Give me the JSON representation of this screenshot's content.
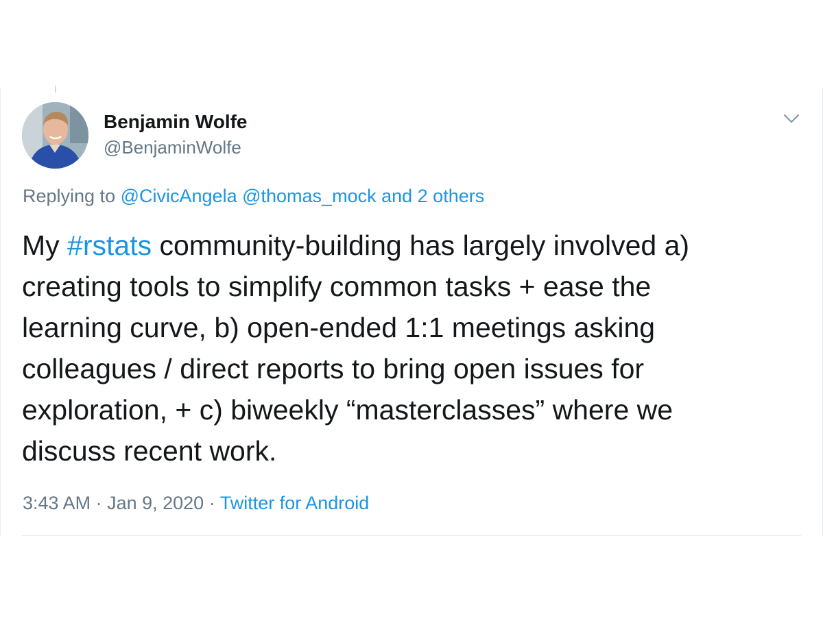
{
  "author": {
    "name": "Benjamin Wolfe",
    "handle": "@BenjaminWolfe"
  },
  "reply": {
    "prefix": "Replying to",
    "mention_1": "@CivicAngela",
    "mention_2": "@thomas_mock",
    "others": "and 2 others"
  },
  "tweet": {
    "line1_a": "My ",
    "hashtag": "#rstats",
    "line1_b": " community-building has largely involved a)",
    "line2": "creating tools to simplify common tasks + ease the",
    "line3": "learning curve, b) open-ended 1:1 meetings asking",
    "line4": "colleagues / direct reports to bring open issues for",
    "line5": "exploration, + c) biweekly “masterclasses” where we",
    "line6": "discuss recent work."
  },
  "meta": {
    "time": "3:43 AM",
    "separator": " · ",
    "date": "Jan 9, 2020",
    "source": "Twitter for Android"
  },
  "icons": {
    "avatar": "avatar-photo",
    "menu": "chevron-down-icon"
  },
  "colors": {
    "link": "#1b95e0",
    "text": "#14171a",
    "secondary": "#657786",
    "border": "#e6ecf0"
  }
}
